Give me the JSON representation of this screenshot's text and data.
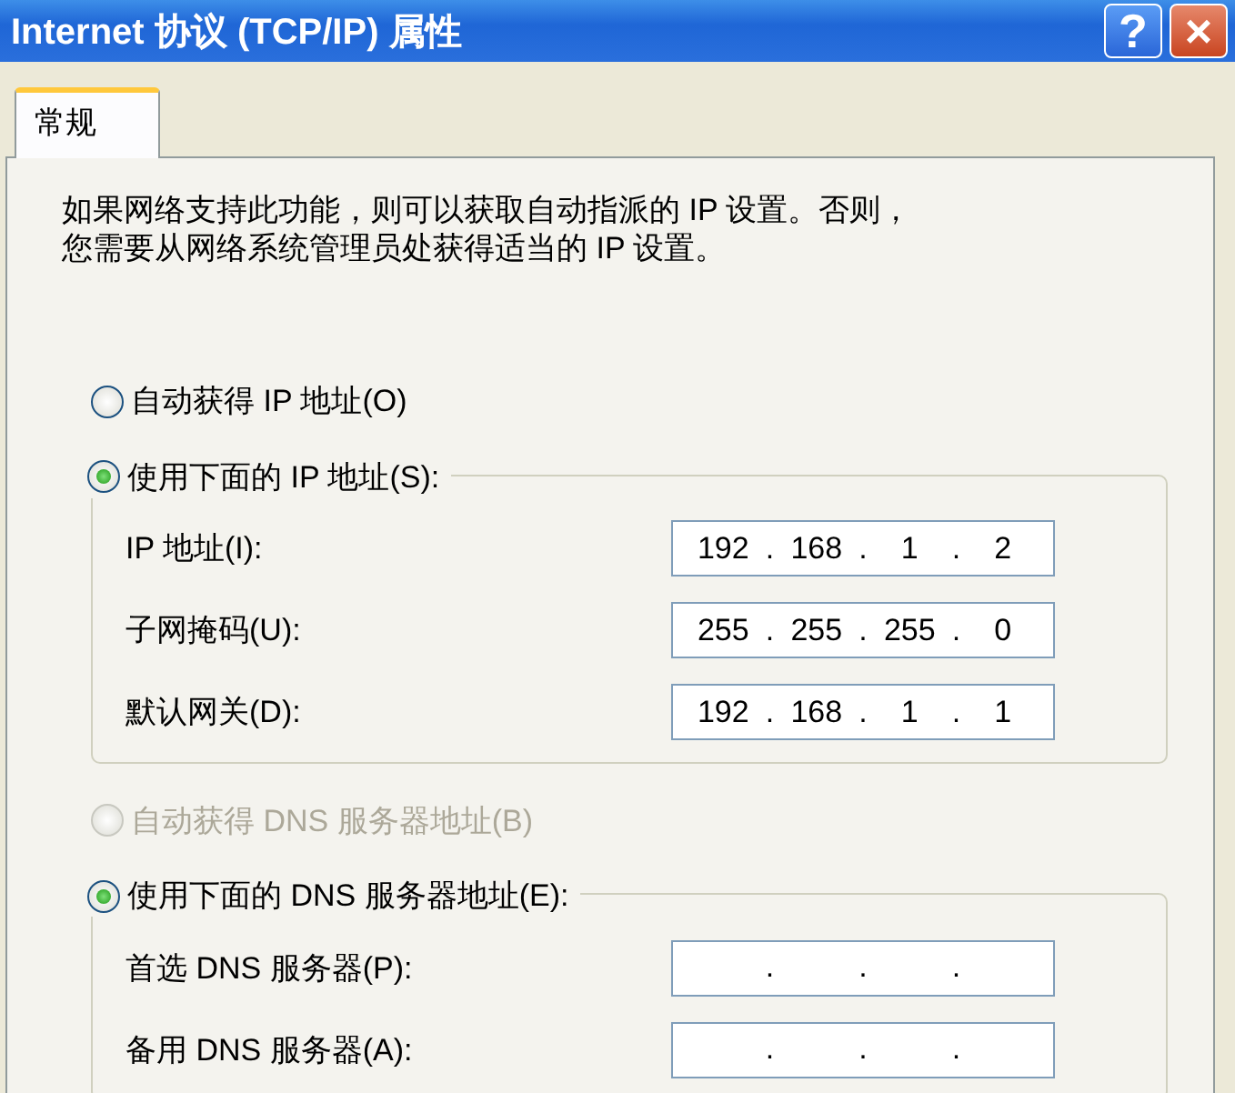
{
  "window": {
    "title": "Internet 协议 (TCP/IP) 属性",
    "buttons": [
      {
        "kind": "help",
        "label": "?"
      },
      {
        "kind": "close",
        "label": "×"
      }
    ]
  },
  "tabs": [
    {
      "label": "常规",
      "selected": true
    }
  ],
  "description_lines": [
    "如果网络支持此功能，则可以获取自动指派的 IP 设置。否则，",
    "您需要从网络系统管理员处获得适当的 IP 设置。"
  ],
  "separator": ".",
  "sections": [
    {
      "auto_option": {
        "label": "自动获得 IP 地址(O)",
        "selected": false,
        "disabled": false
      },
      "manual_option": {
        "label": "使用下面的 IP 地址(S):",
        "selected": true,
        "disabled": false
      },
      "fields": [
        {
          "label": "IP 地址(I):",
          "octets": [
            "192",
            "168",
            "1",
            "2"
          ]
        },
        {
          "label": "子网掩码(U):",
          "octets": [
            "255",
            "255",
            "255",
            "0"
          ]
        },
        {
          "label": "默认网关(D):",
          "octets": [
            "192",
            "168",
            "1",
            "1"
          ]
        }
      ]
    },
    {
      "auto_option": {
        "label": "自动获得 DNS 服务器地址(B)",
        "selected": false,
        "disabled": true
      },
      "manual_option": {
        "label": "使用下面的 DNS 服务器地址(E):",
        "selected": true,
        "disabled": false
      },
      "fields": [
        {
          "label": "首选 DNS 服务器(P):"
        },
        {
          "label": "备用 DNS 服务器(A):"
        }
      ]
    }
  ]
}
